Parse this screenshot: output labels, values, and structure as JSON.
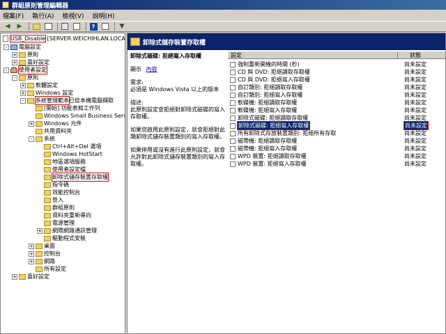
{
  "window": {
    "title": "群組原則管理編輯器"
  },
  "menu": [
    "檔案(F)",
    "執行(A)",
    "檢視(V)",
    "說明(H)"
  ],
  "toolbar": [
    "back-icon",
    "forward-icon",
    "up-icon",
    "show-hide-tree-icon",
    "export-icon",
    "properties-icon",
    "help-icon",
    "view-icon",
    "filter-icon"
  ],
  "tree": {
    "root": "USB_Disable [SERVER.WEICHIHLAN.LOCA",
    "items": [
      {
        "label": "電腦設定",
        "indent": 1,
        "icon": "pc",
        "exp": "-"
      },
      {
        "label": "原則",
        "indent": 2,
        "icon": "fold",
        "exp": "+"
      },
      {
        "label": "喜好設定",
        "indent": 2,
        "icon": "fold",
        "exp": "+"
      },
      {
        "label": "使用者設定",
        "indent": 1,
        "icon": "usr",
        "exp": "-",
        "red": true
      },
      {
        "label": "原則",
        "indent": 2,
        "icon": "fold",
        "exp": "-"
      },
      {
        "label": "軟體設定",
        "indent": 3,
        "icon": "fold",
        "exp": "+"
      },
      {
        "label": "Windows 設定",
        "indent": 3,
        "icon": "fold",
        "exp": "+"
      },
      {
        "label": "系統管理範本",
        "suffix": " 已從本機電腦擷取",
        "indent": 3,
        "icon": "fold",
        "exp": "-",
        "red": true
      },
      {
        "label": "[開始] 功能表和工作列",
        "indent": 4,
        "icon": "fold",
        "exp": ""
      },
      {
        "label": "Windows Small Business Server",
        "indent": 4,
        "icon": "fold",
        "exp": ""
      },
      {
        "label": "Windows 元件",
        "indent": 4,
        "icon": "fold",
        "exp": "+"
      },
      {
        "label": "共用資料夾",
        "indent": 4,
        "icon": "fold",
        "exp": ""
      },
      {
        "label": "系統",
        "indent": 4,
        "icon": "fold",
        "exp": "-"
      },
      {
        "label": "Ctrl+Alt+Del 選項",
        "indent": 5,
        "icon": "fold",
        "exp": ""
      },
      {
        "label": "Windows HotStart",
        "indent": 5,
        "icon": "fold",
        "exp": ""
      },
      {
        "label": "地區選項服務",
        "indent": 5,
        "icon": "fold",
        "exp": ""
      },
      {
        "label": "使用者設定檔",
        "indent": 5,
        "icon": "fold",
        "exp": ""
      },
      {
        "label": "卸除式儲存裝置存取權",
        "indent": 5,
        "icon": "fold",
        "exp": "",
        "red": true
      },
      {
        "label": "指令碼",
        "indent": 5,
        "icon": "fold",
        "exp": ""
      },
      {
        "label": "效能控制台",
        "indent": 5,
        "icon": "fold",
        "exp": ""
      },
      {
        "label": "登入",
        "indent": 5,
        "icon": "fold",
        "exp": ""
      },
      {
        "label": "群組原則",
        "indent": 5,
        "icon": "fold",
        "exp": ""
      },
      {
        "label": "資料夾重新導向",
        "indent": 5,
        "icon": "fold",
        "exp": ""
      },
      {
        "label": "電源管理",
        "indent": 5,
        "icon": "fold",
        "exp": ""
      },
      {
        "label": "網際網路通訊管理",
        "indent": 5,
        "icon": "fold",
        "exp": "+"
      },
      {
        "label": "驅動程式安裝",
        "indent": 5,
        "icon": "fold",
        "exp": ""
      },
      {
        "label": "桌面",
        "indent": 4,
        "icon": "fold",
        "exp": "+"
      },
      {
        "label": "控制台",
        "indent": 4,
        "icon": "fold",
        "exp": "+"
      },
      {
        "label": "網路",
        "indent": 4,
        "icon": "fold",
        "exp": "+"
      },
      {
        "label": "所有設定",
        "indent": 4,
        "icon": "fold",
        "exp": ""
      },
      {
        "label": "喜好設定",
        "indent": 2,
        "icon": "fold",
        "exp": "+"
      }
    ]
  },
  "panel": {
    "header": "卸除式儲存裝置存取權",
    "desc_title": "卸除式磁碟: 拒絕寫入存取權",
    "show_label": "顯示",
    "show_link": "內容",
    "req_label": "需求:",
    "req_text": "必須是 Windows Vista 以上的版本",
    "desc_label": "描述:",
    "desc_text": "此原則設定會拒絕對卸除式磁碟的寫入存取權。",
    "desc_enable": "如果您啟用此原則設定，就會拒絕對此類卸除式儲存裝置類別的寫入存取權。",
    "desc_disable": "如果停用或沒有進行此原則設定，就會允許對此卸除式儲存裝置類別的寫入存取權。"
  },
  "list": {
    "col_setting": "設定",
    "col_state": "狀態",
    "rows": [
      {
        "name": "強制重新開機的時間 (秒)",
        "state": "尚未設定"
      },
      {
        "name": "CD 與 DVD: 拒絕讀取存取權",
        "state": "尚未設定"
      },
      {
        "name": "CD 與 DVD: 拒絕寫入存取權",
        "state": "尚未設定"
      },
      {
        "name": "自訂類別: 拒絕讀取存取權",
        "state": "尚未設定"
      },
      {
        "name": "自訂類別: 拒絕寫入存取權",
        "state": "尚未設定"
      },
      {
        "name": "軟碟機: 拒絕讀取存取權",
        "state": "尚未設定"
      },
      {
        "name": "軟碟機: 拒絕寫入存取權",
        "state": "尚未設定"
      },
      {
        "name": "卸除式磁碟: 拒絕讀取存取權",
        "state": "尚未設定"
      },
      {
        "name": "卸除式磁碟: 拒絕寫入存取權",
        "state": "尚未設定",
        "selected": true
      },
      {
        "name": "所有卸除式存放裝置類別: 拒絕所有存取",
        "state": "尚未設定"
      },
      {
        "name": "磁帶機: 拒絕讀取存取權",
        "state": "尚未設定"
      },
      {
        "name": "磁帶機: 拒絕寫入存取權",
        "state": "尚未設定"
      },
      {
        "name": "WPD 裝置: 拒絕讀取存取權",
        "state": "尚未設定"
      },
      {
        "name": "WPD 裝置: 拒絕寫入存取權",
        "state": "尚未設定"
      }
    ]
  }
}
